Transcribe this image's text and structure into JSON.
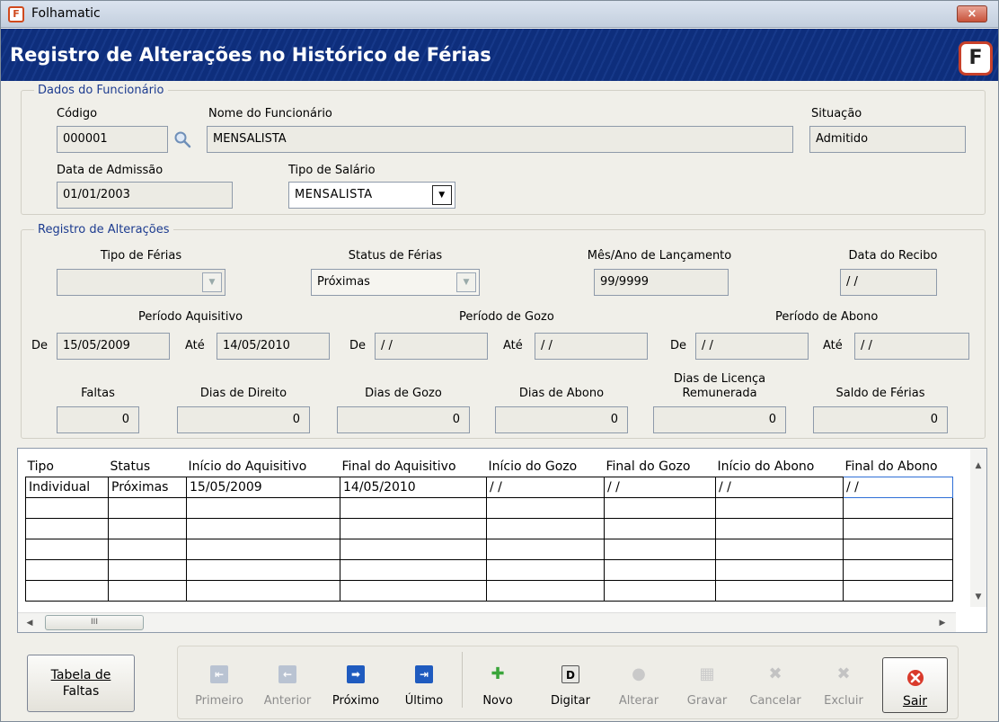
{
  "window": {
    "title": "Folhamatic",
    "close_label": "×"
  },
  "banner": {
    "heading": "Registro de Alterações no Histórico de Férias"
  },
  "dados": {
    "legend": "Dados do Funcionário",
    "codigo_label": "Código",
    "codigo_value": "000001",
    "nome_label": "Nome do Funcionário",
    "nome_value": "MENSALISTA",
    "situacao_label": "Situação",
    "situacao_value": "Admitido",
    "admissao_label": "Data de Admissão",
    "admissao_value": "01/01/2003",
    "tipo_salario_label": "Tipo de Salário",
    "tipo_salario_value": "MENSALISTA"
  },
  "registro": {
    "legend": "Registro de Alterações",
    "tipo_ferias_label": "Tipo de Férias",
    "tipo_ferias_value": "",
    "status_label": "Status de Férias",
    "status_value": "Próximas",
    "mes_ano_label": "Mês/Ano de Lançamento",
    "mes_ano_value": "99/9999",
    "data_recibo_label": "Data do Recibo",
    "data_recibo_value": "/ /",
    "periodo_aquisitivo_label": "Período Aquisitivo",
    "periodo_gozo_label": "Período de Gozo",
    "periodo_abono_label": "Período de Abono",
    "de_label": "De",
    "ate_label": "Até",
    "aquisitivo_de": "15/05/2009",
    "aquisitivo_ate": "14/05/2010",
    "gozo_de": "/ /",
    "gozo_ate": "/ /",
    "abono_de": "/ /",
    "abono_ate": "/ /",
    "faltas_label": "Faltas",
    "faltas_value": "0",
    "dias_direito_label": "Dias de Direito",
    "dias_direito_value": "0",
    "dias_gozo_label": "Dias de Gozo",
    "dias_gozo_value": "0",
    "dias_abono_label": "Dias de Abono",
    "dias_abono_value": "0",
    "dias_licenca_label_1": "Dias de Licença",
    "dias_licenca_label_2": "Remunerada",
    "dias_licenca_value": "0",
    "saldo_label": "Saldo de Férias",
    "saldo_value": "0"
  },
  "grid": {
    "columns": [
      "Tipo",
      "Status",
      "Início do Aquisitivo",
      "Final do Aquisitivo",
      "Início do Gozo",
      "Final do Gozo",
      "Início do Abono",
      "Final do Abono"
    ],
    "rows": [
      [
        "Individual",
        "Próximas",
        "15/05/2009",
        "14/05/2010",
        "/ /",
        "/ /",
        "/ /",
        "/ /"
      ],
      [
        "",
        "",
        "",
        "",
        "",
        "",
        "",
        ""
      ],
      [
        "",
        "",
        "",
        "",
        "",
        "",
        "",
        ""
      ],
      [
        "",
        "",
        "",
        "",
        "",
        "",
        "",
        ""
      ],
      [
        "",
        "",
        "",
        "",
        "",
        "",
        "",
        ""
      ],
      [
        "",
        "",
        "",
        "",
        "",
        "",
        "",
        ""
      ]
    ],
    "scroll_thumb": "III"
  },
  "footer": {
    "tabela_faltas_1": "Tabela de",
    "tabela_faltas_2": "Faltas",
    "buttons": [
      {
        "label": "Primeiro",
        "icon": "first-arrow-icon",
        "enabled": false
      },
      {
        "label": "Anterior",
        "icon": "previous-arrow-icon",
        "enabled": false
      },
      {
        "label": "Próximo",
        "icon": "next-arrow-icon",
        "enabled": true
      },
      {
        "label": "Último",
        "icon": "last-arrow-icon",
        "enabled": true
      },
      {
        "label": "Novo",
        "icon": "new-plus-icon",
        "enabled": true
      },
      {
        "label": "Digitar",
        "icon": "type-d-icon",
        "enabled": true
      },
      {
        "label": "Alterar",
        "icon": "edit-icon",
        "enabled": false
      },
      {
        "label": "Gravar",
        "icon": "save-icon",
        "enabled": false
      },
      {
        "label": "Cancelar",
        "icon": "cancel-x-icon",
        "enabled": false
      },
      {
        "label": "Excluir",
        "icon": "delete-x-icon",
        "enabled": false
      }
    ],
    "sair_label": "Sair"
  },
  "colors": {
    "banner": "#0e2e7c",
    "legend": "#1c3b8f",
    "nav_blue": "#1f5bbf",
    "new_green": "#3aa53a",
    "exit_red": "#d93a2b"
  }
}
